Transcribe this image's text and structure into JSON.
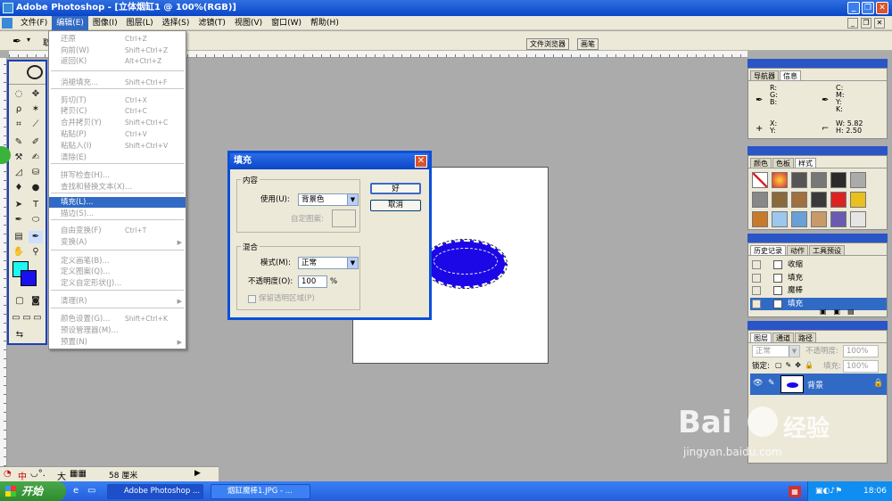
{
  "window": {
    "title": "Adobe Photoshop - [立体烟缸1 @ 100%(RGB)]"
  },
  "menubar": {
    "items": [
      "文件(F)",
      "编辑(E)",
      "图像(I)",
      "图层(L)",
      "选择(S)",
      "滤镜(T)",
      "视图(V)",
      "窗口(W)",
      "帮助(H)"
    ],
    "active_index": 1
  },
  "optbar": {
    "tabs": [
      "文件浏览器",
      "画笔"
    ],
    "label": "取"
  },
  "edit_menu": {
    "items": [
      {
        "label": "还原",
        "shortcut": "Ctrl+Z"
      },
      {
        "label": "向前(W)",
        "shortcut": "Shift+Ctrl+Z"
      },
      {
        "label": "返回(K)",
        "shortcut": "Alt+Ctrl+Z"
      },
      {
        "label": "消褪填充...",
        "shortcut": "Shift+Ctrl+F"
      },
      {
        "label": "剪切(T)",
        "shortcut": "Ctrl+X"
      },
      {
        "label": "拷贝(C)",
        "shortcut": "Ctrl+C"
      },
      {
        "label": "合并拷贝(Y)",
        "shortcut": "Shift+Ctrl+C"
      },
      {
        "label": "粘贴(P)",
        "shortcut": "Ctrl+V"
      },
      {
        "label": "粘贴入(I)",
        "shortcut": "Shift+Ctrl+V"
      },
      {
        "label": "清除(E)",
        "shortcut": ""
      },
      {
        "label": "拼写检查(H)...",
        "shortcut": ""
      },
      {
        "label": "查找和替换文本(X)...",
        "shortcut": ""
      },
      {
        "label": "填充(L)...",
        "shortcut": ""
      },
      {
        "label": "描边(S)...",
        "shortcut": ""
      },
      {
        "label": "自由变换(F)",
        "shortcut": "Ctrl+T"
      },
      {
        "label": "变换(A)",
        "shortcut": ""
      },
      {
        "label": "定义画笔(B)...",
        "shortcut": ""
      },
      {
        "label": "定义图案(Q)...",
        "shortcut": ""
      },
      {
        "label": "定义自定形状(J)...",
        "shortcut": ""
      },
      {
        "label": "清理(R)",
        "shortcut": ""
      },
      {
        "label": "颜色设置(G)...",
        "shortcut": "Shift+Ctrl+K"
      },
      {
        "label": "预设管理器(M)...",
        "shortcut": ""
      },
      {
        "label": "预置(N)",
        "shortcut": ""
      }
    ]
  },
  "dialog": {
    "title": "填充",
    "content_group": "内容",
    "use_label": "使用(U):",
    "use_value": "背景色",
    "pattern_label": "自定图案:",
    "blend_group": "混合",
    "mode_label": "模式(M):",
    "mode_value": "正常",
    "opacity_label": "不透明度(O):",
    "opacity_value": "100",
    "opacity_unit": "%",
    "preserve_label": "保留透明区域(P)",
    "ok_label": "好",
    "cancel_label": "取消"
  },
  "navigator": {
    "tabs": [
      "导航器",
      "信息"
    ],
    "rgb_labels": [
      "R:",
      "G:",
      "B:"
    ],
    "cmyk_labels": [
      "C:",
      "M:",
      "Y:",
      "K:"
    ],
    "xy_labels": [
      "X:",
      "Y:"
    ],
    "w_label": "W:",
    "w_value": "5.82",
    "h_label": "H:",
    "h_value": "2.50"
  },
  "color_panel": {
    "tabs": [
      "颜色",
      "色板",
      "样式"
    ]
  },
  "history_panel": {
    "tabs": [
      "历史记录",
      "动作",
      "工具预设"
    ],
    "items": [
      "收缩",
      "填充",
      "魔棒",
      "填充"
    ],
    "active_index": 3
  },
  "layers_panel": {
    "tabs": [
      "图层",
      "通道",
      "路径"
    ],
    "mode": "正常",
    "opacity_label": "不透明度:",
    "opacity_value": "100%",
    "lock_label": "锁定:",
    "fill_label": "填充:",
    "fill_value": "100%",
    "layer_name": "背景"
  },
  "statusbar": {
    "ime": "中",
    "ime_extra": "大",
    "size": "58 厘米"
  },
  "taskbar": {
    "start_label": "开始",
    "tasks": [
      "Adobe Photoshop ...",
      "烟缸魔棒1.JPG - ..."
    ],
    "clock": "18:06"
  },
  "watermark": {
    "brand": "Bai",
    "brand2": "经验",
    "url": "jingyan.baidu.com"
  },
  "colors": {
    "foreground": "#1ef6f0",
    "background": "#1a10ee",
    "accent": "#316ac5"
  }
}
